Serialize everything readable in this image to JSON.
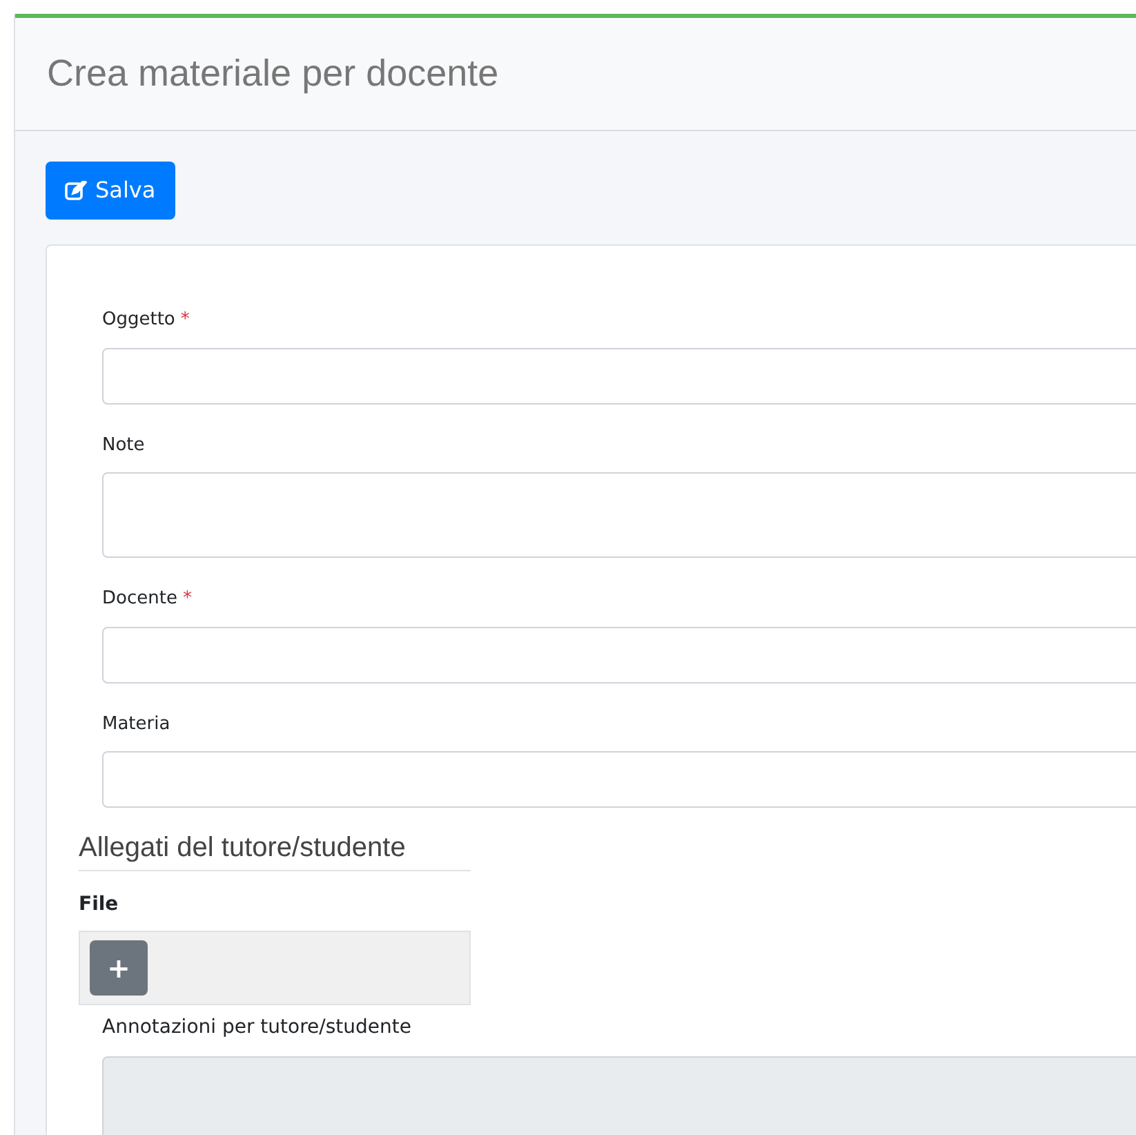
{
  "header": {
    "title": "Crea materiale per docente"
  },
  "save_button": {
    "label": "Salva"
  },
  "fields": [
    {
      "label": "Oggetto",
      "required_mark": "*",
      "kind": "input"
    },
    {
      "label": "Note",
      "kind": "textarea"
    },
    {
      "label": "Docente",
      "required_mark": "*",
      "kind": "input"
    },
    {
      "label": "Materia",
      "kind": "input"
    }
  ],
  "attachments": {
    "title": "Allegati del tutore/studente",
    "file_label": "File",
    "add_button": "+",
    "notes_label": "Annotazioni per tutore/studente",
    "notes_disabled": true
  }
}
